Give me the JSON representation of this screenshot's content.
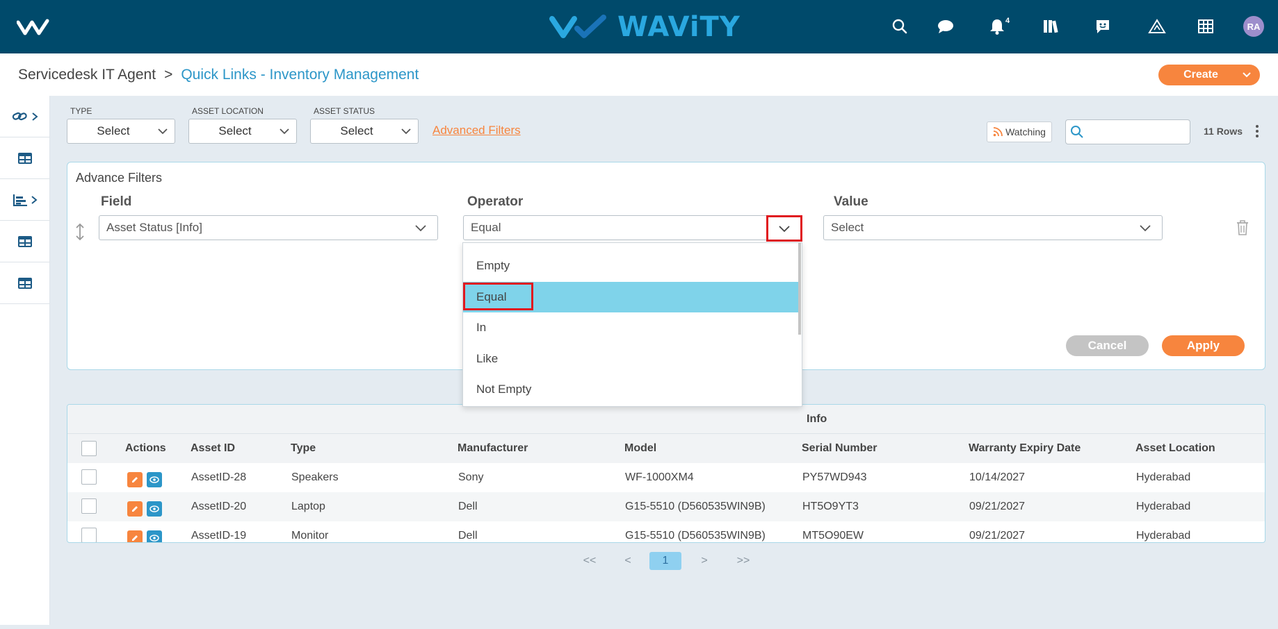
{
  "topbar": {
    "brand": "WAViTY",
    "notification_count": "4",
    "avatar_initials": "RA",
    "icons": [
      "search-icon",
      "chat-icon",
      "bell-icon",
      "library-icon",
      "feedback-icon",
      "alert-icon",
      "grid-icon"
    ]
  },
  "breadcrumb": {
    "root": "Servicedesk IT Agent",
    "separator": ">",
    "current": "Quick Links - Inventory Management"
  },
  "create_button": "Create",
  "sidebar": {
    "items": [
      {
        "icon": "link-icon"
      },
      {
        "icon": "table-icon"
      },
      {
        "icon": "bar-chart-icon"
      },
      {
        "icon": "table-icon"
      },
      {
        "icon": "table-icon"
      }
    ]
  },
  "filters": {
    "type": {
      "label": "TYPE",
      "value": "Select"
    },
    "asset_location": {
      "label": "ASSET LOCATION",
      "value": "Select"
    },
    "asset_status": {
      "label": "ASSET STATUS",
      "value": "Select"
    },
    "advanced_link": "Advanced Filters",
    "watching": "Watching",
    "search_placeholder": "",
    "rows_count": "11 Rows"
  },
  "advance_filters": {
    "title": "Advance Filters",
    "headers": {
      "field": "Field",
      "operator": "Operator",
      "value": "Value"
    },
    "field_value": "Asset Status [Info]",
    "operator_value": "Equal",
    "value_value": "Select",
    "cancel": "Cancel",
    "apply": "Apply",
    "operator_options": [
      "Empty",
      "Equal",
      "In",
      "Like",
      "Not Empty"
    ],
    "selected_option": "Equal"
  },
  "table": {
    "group_header": "Info",
    "columns": [
      "Actions",
      "Asset ID",
      "Type",
      "Manufacturer",
      "Model",
      "Serial Number",
      "Warranty Expiry Date",
      "Asset Location"
    ],
    "rows": [
      [
        "AssetID-28",
        "Speakers",
        "Sony",
        "WF-1000XM4",
        "PY57WD943",
        "10/14/2027",
        "Hyderabad"
      ],
      [
        "AssetID-20",
        "Laptop",
        "Dell",
        "G15-5510 (D560535WIN9B)",
        "HT5O9YT3",
        "09/21/2027",
        "Hyderabad"
      ],
      [
        "AssetID-19",
        "Monitor",
        "Dell",
        "G15-5510 (D560535WIN9B)",
        "MT5O90EW",
        "09/21/2027",
        "Hyderabad"
      ]
    ]
  },
  "pagination": {
    "first": "<<",
    "prev": "<",
    "current": "1",
    "next": ">",
    "last": ">>"
  },
  "colors": {
    "topbar": "#004a6b",
    "accent_orange": "#f7853e",
    "accent_blue": "#2c96c8",
    "highlight": "#7fd3ea",
    "annotation_red": "#e0191f"
  }
}
